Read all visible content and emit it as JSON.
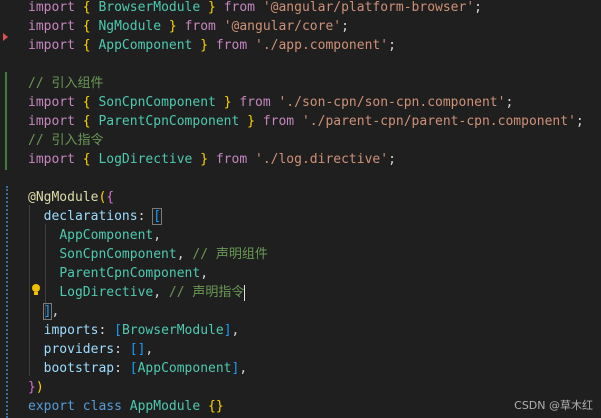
{
  "lines": {
    "l1": {
      "kw": "import",
      "ob": "{",
      "cls": "BrowserModule",
      "cb": "}",
      "from": "from",
      "str": "'@angular/platform-browser'",
      "semi": ";"
    },
    "l2": {
      "kw": "import",
      "ob": "{",
      "cls": "NgModule",
      "cb": "}",
      "from": "from",
      "str": "'@angular/core'",
      "semi": ";"
    },
    "l3": {
      "kw": "import",
      "ob": "{",
      "cls": "AppComponent",
      "cb": "}",
      "from": "from",
      "str": "'./app.component'",
      "semi": ";"
    },
    "l5": {
      "cmt": "// 引入组件"
    },
    "l6": {
      "kw": "import",
      "ob": "{",
      "cls": "SonCpnComponent",
      "cb": "}",
      "from": "from",
      "str": "'./son-cpn/son-cpn.component'",
      "semi": ";"
    },
    "l7": {
      "kw": "import",
      "ob": "{",
      "cls": "ParentCpnComponent",
      "cb": "}",
      "from": "from",
      "str": "'./parent-cpn/parent-cpn.component'",
      "semi": ";"
    },
    "l8": {
      "cmt": "// 引入指令"
    },
    "l9": {
      "kw": "import",
      "ob": "{",
      "cls": "LogDirective",
      "cb": "}",
      "from": "from",
      "str": "'./log.directive'",
      "semi": ";"
    },
    "l11": {
      "at": "@",
      "dec": "NgModule",
      "op": "(",
      "ob": "{"
    },
    "l12": {
      "prop": "declarations",
      "colon": ":",
      "ob": "["
    },
    "l13": {
      "cls": "AppComponent",
      "comma": ","
    },
    "l14": {
      "cls": "SonCpnComponent",
      "comma": ",",
      "cmt": "// 声明组件"
    },
    "l15": {
      "cls": "ParentCpnComponent",
      "comma": ","
    },
    "l16": {
      "cls": "LogDirective",
      "comma": ",",
      "cmt": "// 声明指令"
    },
    "l17": {
      "cb": "]",
      "comma": ","
    },
    "l18": {
      "prop": "imports",
      "colon": ":",
      "ob": "[",
      "cls": "BrowserModule",
      "cb": "]",
      "comma": ","
    },
    "l19": {
      "prop": "providers",
      "colon": ":",
      "brackets": "[]",
      "comma": ","
    },
    "l20": {
      "prop": "bootstrap",
      "colon": ":",
      "ob": "[",
      "cls": "AppComponent",
      "cb": "]",
      "comma": ","
    },
    "l21": {
      "cb": "}",
      "cp": ")"
    },
    "l22": {
      "kw": "export",
      "kw2": "class",
      "cls": "AppModule",
      "braces": "{}"
    }
  },
  "watermark": "CSDN @草木红",
  "colors": {
    "background": "#1f1f1f",
    "keyword": "#c586c0",
    "string": "#ce9178",
    "class": "#4ec9b0",
    "property": "#9cdcfe",
    "comment": "#6a9955",
    "decorator": "#dcdcaa"
  },
  "icons": [
    "lightbulb-icon",
    "fold-arrow-icon"
  ]
}
